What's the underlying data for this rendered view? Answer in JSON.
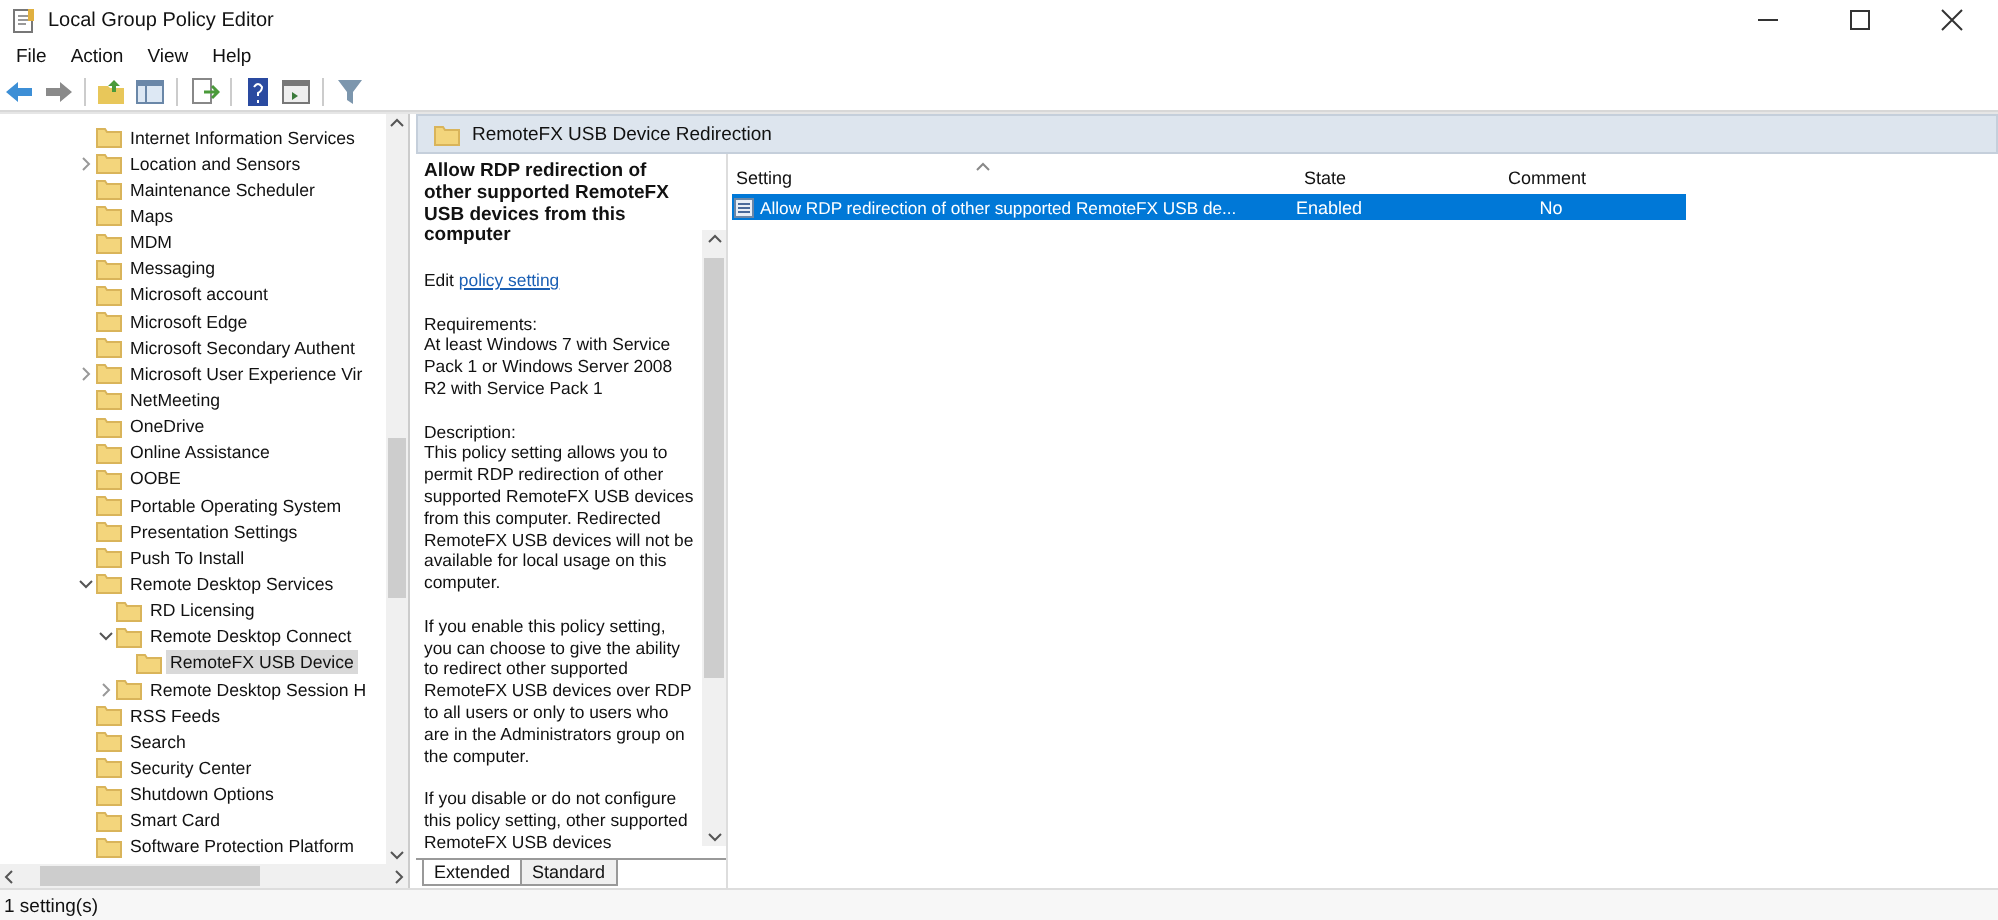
{
  "window": {
    "title": "Local Group Policy Editor"
  },
  "menu": [
    "File",
    "Action",
    "View",
    "Help"
  ],
  "tree": [
    {
      "label": "Internet Information Services",
      "selected": false
    },
    {
      "label": "Location and Sensors",
      "expanded": false,
      "selected": false
    },
    {
      "label": "Maintenance Scheduler",
      "selected": false
    },
    {
      "label": "Maps",
      "selected": false
    },
    {
      "label": "MDM",
      "selected": false
    },
    {
      "label": "Messaging",
      "selected": false
    },
    {
      "label": "Microsoft account",
      "selected": false
    },
    {
      "label": "Microsoft Edge",
      "selected": false
    },
    {
      "label": "Microsoft Secondary Authent",
      "selected": false
    },
    {
      "label": "Microsoft User Experience Vir",
      "expanded": false,
      "selected": false
    },
    {
      "label": "NetMeeting",
      "selected": false
    },
    {
      "label": "OneDrive",
      "selected": false
    },
    {
      "label": "Online Assistance",
      "selected": false
    },
    {
      "label": "OOBE",
      "selected": false
    },
    {
      "label": "Portable Operating System",
      "selected": false
    },
    {
      "label": "Presentation Settings",
      "selected": false
    },
    {
      "label": "Push To Install",
      "selected": false
    },
    {
      "label": "Remote Desktop Services",
      "expanded": true,
      "selected": false,
      "children": [
        {
          "label": "RD Licensing",
          "selected": false
        },
        {
          "label": "Remote Desktop Connect",
          "expanded": true,
          "selected": false,
          "children": [
            {
              "label": "RemoteFX USB Device",
              "selected": true
            }
          ]
        },
        {
          "label": "Remote Desktop Session H",
          "expanded": false,
          "selected": false
        }
      ]
    },
    {
      "label": "RSS Feeds",
      "selected": false
    },
    {
      "label": "Search",
      "selected": false
    },
    {
      "label": "Security Center",
      "selected": false
    },
    {
      "label": "Shutdown Options",
      "selected": false
    },
    {
      "label": "Smart Card",
      "selected": false
    },
    {
      "label": "Software Protection Platform",
      "selected": false
    }
  ],
  "folder_header": "RemoteFX USB Device Redirection",
  "description": {
    "title": "Allow RDP redirection of other supported RemoteFX USB devices from this computer",
    "edit_prefix": "Edit",
    "edit_link": "policy setting",
    "requirements_label": "Requirements:",
    "requirements": "At least Windows 7 with Service Pack 1 or Windows Server 2008 R2 with Service Pack 1",
    "description_label": "Description:",
    "paragraphs": [
      "This policy setting allows you to permit RDP redirection of other supported RemoteFX USB devices from this computer. Redirected RemoteFX USB devices will not be available for local usage on this computer.",
      "If you enable this policy setting, you can choose to give the ability to redirect other supported RemoteFX USB devices over RDP to all users or only to users who are in the Administrators group on the computer.",
      "If you disable or do not configure this policy setting, other supported RemoteFX USB devices"
    ]
  },
  "table": {
    "columns": [
      "Setting",
      "State",
      "Comment"
    ],
    "rows": [
      {
        "setting": "Allow RDP redirection of other supported RemoteFX USB de...",
        "state": "Enabled",
        "comment": "No",
        "selected": true
      }
    ]
  },
  "view_tabs": [
    {
      "label": "Extended",
      "selected": true
    },
    {
      "label": "Standard",
      "selected": false
    }
  ],
  "status_bar": "1 setting(s)"
}
